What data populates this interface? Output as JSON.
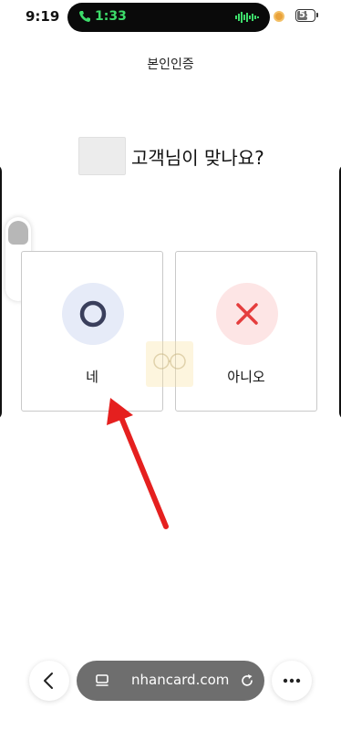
{
  "status_bar": {
    "time": "9:19",
    "call_time": "1:33",
    "battery": "55",
    "battery_level_percent": 55
  },
  "page": {
    "title": "본인인증",
    "question": "고객님이 맞나요?"
  },
  "choices": {
    "yes_label": "네",
    "no_label": "아니오"
  },
  "browser": {
    "url": "nhancard.com"
  },
  "colors": {
    "accent_dark": "#3a3f5c",
    "no_red": "#e53d3d",
    "arrow_red": "#e5201f",
    "call_green": "#3ddc6a"
  },
  "icons": {
    "yes": "circle-o-icon",
    "no": "x-icon",
    "back": "chevron-left-icon",
    "tabs": "tabs-icon",
    "reload": "reload-icon",
    "more": "more-dots-icon",
    "call": "phone-icon"
  }
}
